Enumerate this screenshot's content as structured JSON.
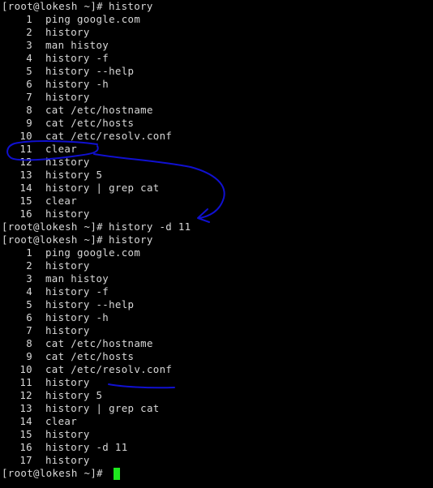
{
  "terminal": {
    "prompt": "[root@lokesh ~]#",
    "cursor_color": "#1ee81e",
    "annotation_color": "#1010d0"
  },
  "blocks": [
    {
      "command": "history",
      "entries": [
        {
          "n": "1",
          "cmd": "ping google.com"
        },
        {
          "n": "2",
          "cmd": "history"
        },
        {
          "n": "3",
          "cmd": "man histoy"
        },
        {
          "n": "4",
          "cmd": "history -f"
        },
        {
          "n": "5",
          "cmd": "history --help"
        },
        {
          "n": "6",
          "cmd": "history -h"
        },
        {
          "n": "7",
          "cmd": "history"
        },
        {
          "n": "8",
          "cmd": "cat /etc/hostname"
        },
        {
          "n": "9",
          "cmd": "cat /etc/hosts"
        },
        {
          "n": "10",
          "cmd": "cat /etc/resolv.conf"
        },
        {
          "n": "11",
          "cmd": "clear"
        },
        {
          "n": "12",
          "cmd": "history"
        },
        {
          "n": "13",
          "cmd": "history 5"
        },
        {
          "n": "14",
          "cmd": "history | grep cat"
        },
        {
          "n": "15",
          "cmd": "clear"
        },
        {
          "n": "16",
          "cmd": "history"
        }
      ]
    },
    {
      "command": "history -d 11",
      "entries": []
    },
    {
      "command": "history",
      "entries": [
        {
          "n": "1",
          "cmd": "ping google.com"
        },
        {
          "n": "2",
          "cmd": "history"
        },
        {
          "n": "3",
          "cmd": "man histoy"
        },
        {
          "n": "4",
          "cmd": "history -f"
        },
        {
          "n": "5",
          "cmd": "history --help"
        },
        {
          "n": "6",
          "cmd": "history -h"
        },
        {
          "n": "7",
          "cmd": "history"
        },
        {
          "n": "8",
          "cmd": "cat /etc/hostname"
        },
        {
          "n": "9",
          "cmd": "cat /etc/hosts"
        },
        {
          "n": "10",
          "cmd": "cat /etc/resolv.conf"
        },
        {
          "n": "11",
          "cmd": "history"
        },
        {
          "n": "12",
          "cmd": "history 5"
        },
        {
          "n": "13",
          "cmd": "history | grep cat"
        },
        {
          "n": "14",
          "cmd": "clear"
        },
        {
          "n": "15",
          "cmd": "history"
        },
        {
          "n": "16",
          "cmd": "history -d 11"
        },
        {
          "n": "17",
          "cmd": "history"
        }
      ]
    }
  ],
  "final_prompt": {
    "command": ""
  }
}
